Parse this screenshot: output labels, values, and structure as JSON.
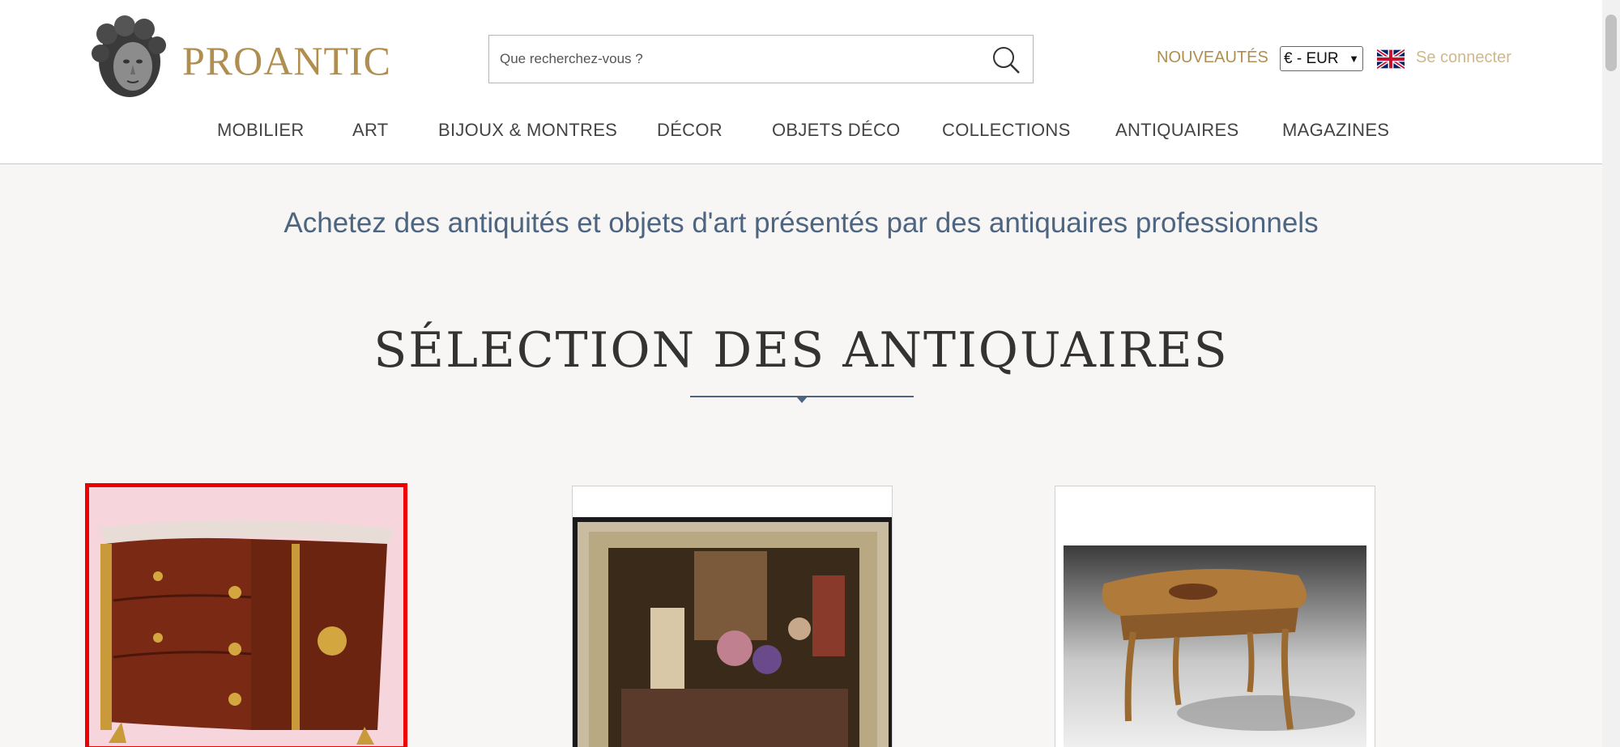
{
  "header": {
    "brand": "PROANTIC",
    "search_placeholder": "Que recherchez-vous ?",
    "nouveautes": "NOUVEAUTÉS",
    "currency": "€ - EUR",
    "login": "Se connecter"
  },
  "nav": {
    "items": [
      "MOBILIER",
      "ART",
      "BIJOUX & MONTRES",
      "DÉCOR",
      "OBJETS DÉCO",
      "COLLECTIONS",
      "ANTIQUAIRES",
      "MAGAZINES"
    ]
  },
  "main": {
    "tagline": "Achetez des antiquités et objets d'art présentés par des antiquaires professionnels",
    "section_title": "SÉLECTION DES ANTIQUAIRES"
  },
  "colors": {
    "brand_gold": "#b08e4f",
    "tagline_blue": "#4d6580",
    "selected_border": "#ee0000"
  },
  "icons": [
    "search-icon",
    "uk-flag-icon",
    "logo-head-icon",
    "chevron-down-icon"
  ]
}
